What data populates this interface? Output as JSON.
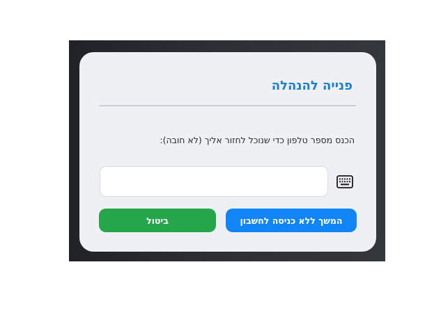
{
  "dialog": {
    "title": "פנייה להנהלה",
    "prompt": "הכנס מספר טלפון כדי שנוכל לחזור אליך (לא חובה):",
    "phone_input": {
      "value": "",
      "placeholder": ""
    },
    "keyboard_icon": "keyboard-icon",
    "continue_button_label": "המשך ללא כניסה לחשבון",
    "cancel_button_label": "ביטול"
  },
  "colors": {
    "title": "#1c7fd6",
    "continue_button": "#1185f5",
    "cancel_button": "#26a64a",
    "dialog_bg": "#eef0f3"
  }
}
